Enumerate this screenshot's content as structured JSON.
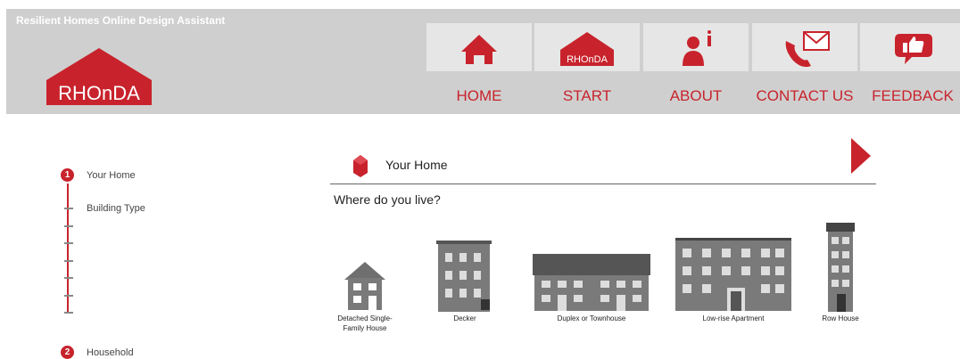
{
  "header": {
    "app_title": "Resilient Homes Online Design Assistant",
    "logo_text": "RHOnDA",
    "nav": [
      {
        "label": "HOME",
        "icon": "home-icon"
      },
      {
        "label": "START",
        "icon": "rhonda-house-icon",
        "icon_text": "RHOnDA"
      },
      {
        "label": "ABOUT",
        "icon": "info-person-icon"
      },
      {
        "label": "CONTACT US",
        "icon": "phone-mail-icon"
      },
      {
        "label": "FEEDBACK",
        "icon": "thumbs-up-bubble-icon"
      }
    ]
  },
  "progress": {
    "steps": [
      {
        "number": "1",
        "label": "Your Home",
        "substeps": [
          "Building Type"
        ]
      },
      {
        "number": "2",
        "label": "Household"
      }
    ]
  },
  "main": {
    "section_title": "Your Home",
    "question": "Where do you live?",
    "building_types": [
      "Detached Single-Family House",
      "Decker",
      "Duplex or Townhouse",
      "Low-rise Apartment",
      "Row House"
    ]
  },
  "colors": {
    "accent": "#c8232c",
    "header_bg": "#cfcfcf",
    "tile_bg": "#e6e6e6"
  }
}
